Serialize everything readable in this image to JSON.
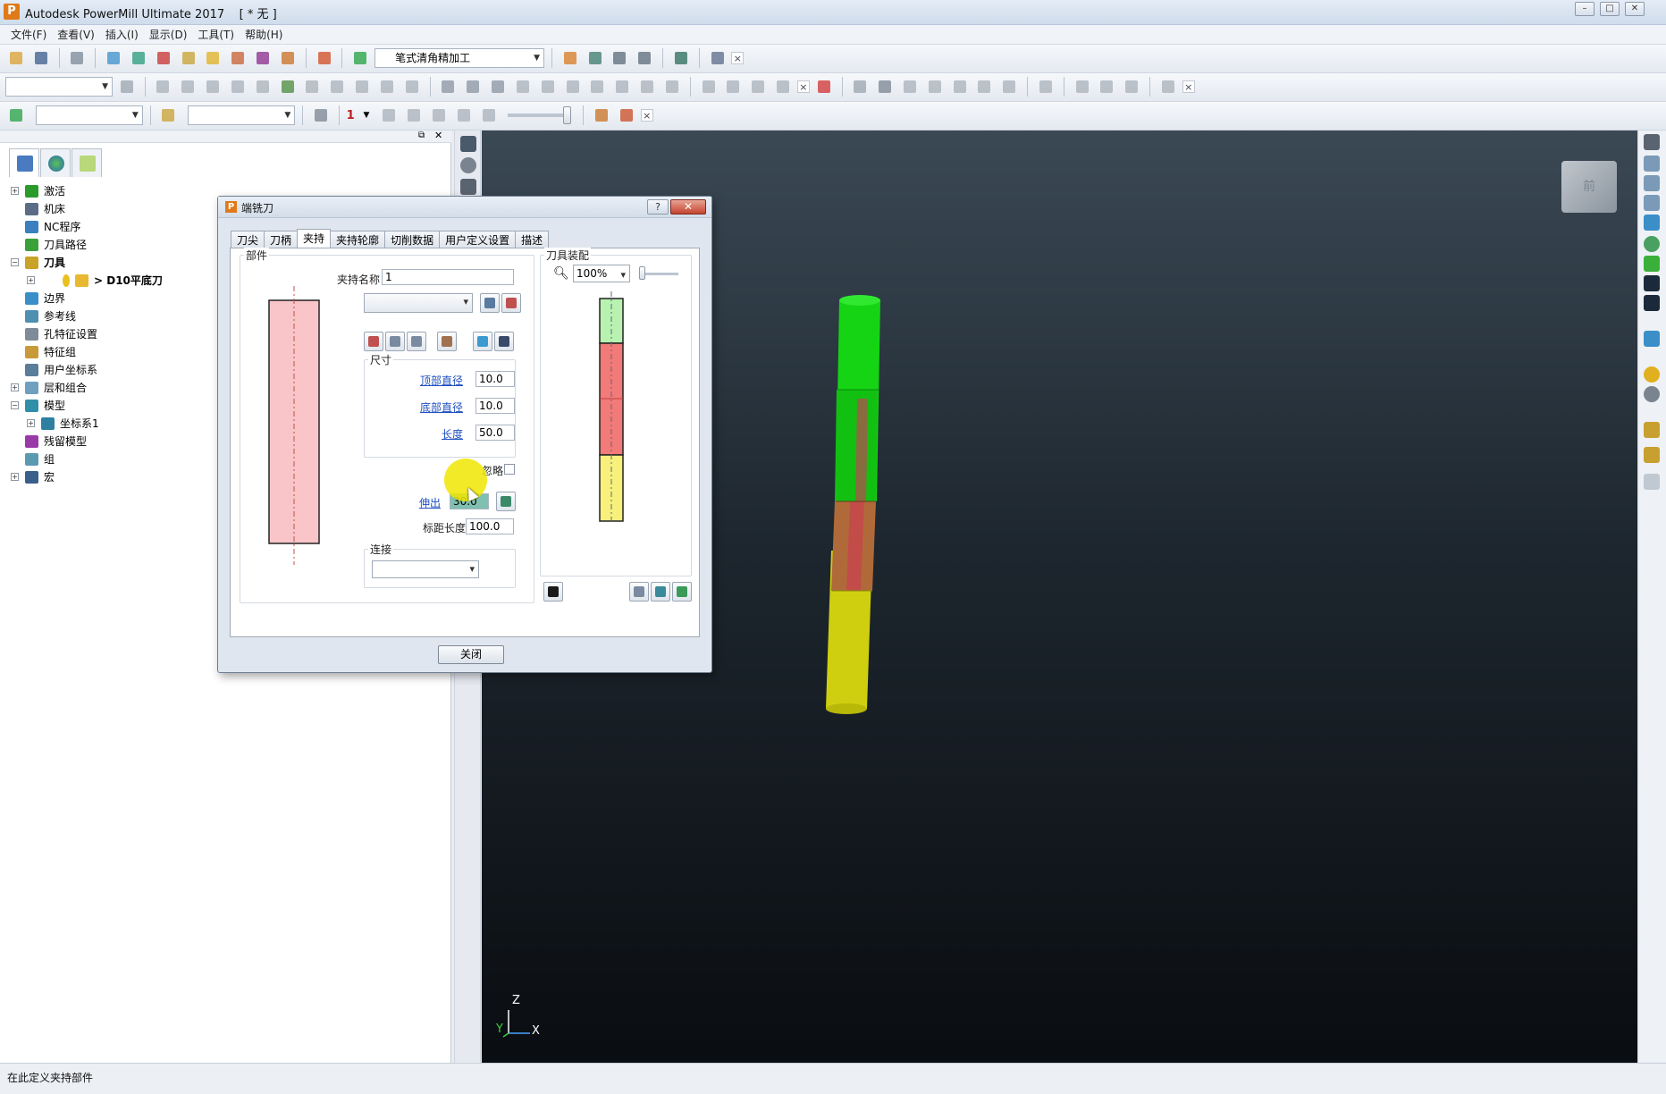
{
  "app": {
    "title": "Autodesk PowerMill Ultimate 2017    [ * 无 ]",
    "icon_letter": "P"
  },
  "window_controls": {
    "minimize": "–",
    "maximize": "□",
    "close": "✕"
  },
  "menu": [
    "文件(F)",
    "查看(V)",
    "插入(I)",
    "显示(D)",
    "工具(T)",
    "帮助(H)"
  ],
  "toolbar1": {
    "strategy_combo": "笔式清角精加工"
  },
  "toolbar3": {
    "tool_number": "1"
  },
  "explorer": {
    "tree": [
      {
        "label": "激活",
        "level": 0,
        "expander": "+",
        "icon_color": "#2a9a2a"
      },
      {
        "label": "机床",
        "level": 0,
        "expander": "",
        "icon_color": "#5b6d86"
      },
      {
        "label": "NC程序",
        "level": 0,
        "expander": "",
        "icon_color": "#3a7fbf"
      },
      {
        "label": "刀具路径",
        "level": 0,
        "expander": "",
        "icon_color": "#3aa13a"
      },
      {
        "label": "刀具",
        "level": 0,
        "expander": "−",
        "icon_color": "#c9a227",
        "bold": true
      },
      {
        "label": "> D10平底刀",
        "level": 1,
        "expander": "+",
        "icon_color": "#e8b830",
        "bold": true
      },
      {
        "label": "边界",
        "level": 0,
        "expander": "",
        "icon_color": "#3a8fc9"
      },
      {
        "label": "参考线",
        "level": 0,
        "expander": "",
        "icon_color": "#4f8fb0"
      },
      {
        "label": "孔特征设置",
        "level": 0,
        "expander": "",
        "icon_color": "#7e8c99"
      },
      {
        "label": "特征组",
        "level": 0,
        "expander": "",
        "icon_color": "#c99a3a"
      },
      {
        "label": "用户坐标系",
        "level": 0,
        "expander": "",
        "icon_color": "#5a7d9a"
      },
      {
        "label": "层和组合",
        "level": 0,
        "expander": "+",
        "icon_color": "#6fa0c0"
      },
      {
        "label": "模型",
        "level": 0,
        "expander": "−",
        "icon_color": "#2f8fa8"
      },
      {
        "label": "坐标系1",
        "level": 1,
        "expander": "+",
        "icon_color": "#2f7fa0"
      },
      {
        "label": "残留模型",
        "level": 0,
        "expander": "",
        "icon_color": "#9a3aa8"
      },
      {
        "label": "组",
        "level": 0,
        "expander": "",
        "icon_color": "#5a9ab0"
      },
      {
        "label": "宏",
        "level": 0,
        "expander": "+",
        "icon_color": "#3a5f8a"
      }
    ]
  },
  "viewport": {
    "viewcube_label": "前",
    "axis": {
      "z": "Z",
      "x": "X",
      "y": "Y"
    }
  },
  "status_bar": {
    "text": "在此定义夹持部件"
  },
  "dialog": {
    "title": "端铣刀",
    "help": "?",
    "close_x": "✕",
    "tabs": [
      "刀尖",
      "刀柄",
      "夹持",
      "夹持轮廓",
      "切削数据",
      "用户定义设置",
      "描述"
    ],
    "active_tab": "夹持",
    "parts_group": "部件",
    "holder_name_label": "夹持名称",
    "holder_name_value": "1",
    "size_group": "尺寸",
    "top_diameter_label": "顶部直径",
    "top_diameter_value": "10.0",
    "bottom_diameter_label": "底部直径",
    "bottom_diameter_value": "10.0",
    "length_label": "长度",
    "length_value": "50.0",
    "ignore_label": "忽略",
    "ignore_checked": false,
    "overhang_label": "伸出",
    "overhang_value": "30.0",
    "gauge_length_label": "标距长度",
    "gauge_length_value": "100.0",
    "connection_group": "连接",
    "assembly_group": "刀具装配",
    "zoom_value": "100%",
    "close_button": "关闭"
  },
  "colors": {
    "holder_preview": "#f9c5c8",
    "assembly_tip": "#b8f2b0",
    "assembly_holder": "#f27a78",
    "assembly_shank": "#f7f07a",
    "model_green": "#14d414",
    "model_red": "#b85050",
    "model_yellow": "#cfcf10"
  }
}
